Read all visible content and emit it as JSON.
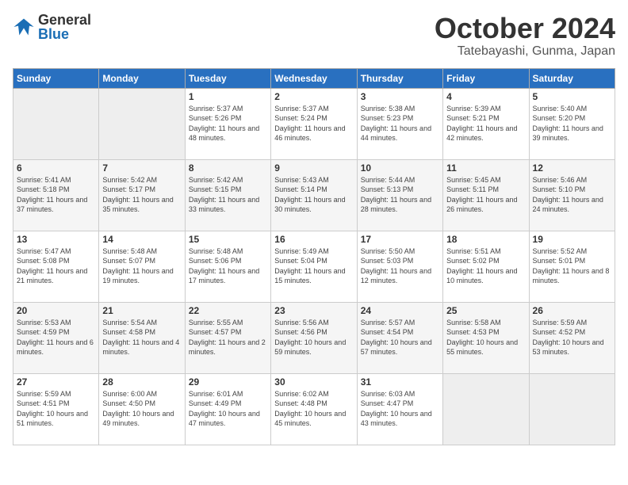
{
  "logo": {
    "general": "General",
    "blue": "Blue"
  },
  "title": "October 2024",
  "location": "Tatebayashi, Gunma, Japan",
  "headers": [
    "Sunday",
    "Monday",
    "Tuesday",
    "Wednesday",
    "Thursday",
    "Friday",
    "Saturday"
  ],
  "weeks": [
    [
      {
        "day": "",
        "info": ""
      },
      {
        "day": "",
        "info": ""
      },
      {
        "day": "1",
        "info": "Sunrise: 5:37 AM\nSunset: 5:26 PM\nDaylight: 11 hours and 48 minutes."
      },
      {
        "day": "2",
        "info": "Sunrise: 5:37 AM\nSunset: 5:24 PM\nDaylight: 11 hours and 46 minutes."
      },
      {
        "day": "3",
        "info": "Sunrise: 5:38 AM\nSunset: 5:23 PM\nDaylight: 11 hours and 44 minutes."
      },
      {
        "day": "4",
        "info": "Sunrise: 5:39 AM\nSunset: 5:21 PM\nDaylight: 11 hours and 42 minutes."
      },
      {
        "day": "5",
        "info": "Sunrise: 5:40 AM\nSunset: 5:20 PM\nDaylight: 11 hours and 39 minutes."
      }
    ],
    [
      {
        "day": "6",
        "info": "Sunrise: 5:41 AM\nSunset: 5:18 PM\nDaylight: 11 hours and 37 minutes."
      },
      {
        "day": "7",
        "info": "Sunrise: 5:42 AM\nSunset: 5:17 PM\nDaylight: 11 hours and 35 minutes."
      },
      {
        "day": "8",
        "info": "Sunrise: 5:42 AM\nSunset: 5:15 PM\nDaylight: 11 hours and 33 minutes."
      },
      {
        "day": "9",
        "info": "Sunrise: 5:43 AM\nSunset: 5:14 PM\nDaylight: 11 hours and 30 minutes."
      },
      {
        "day": "10",
        "info": "Sunrise: 5:44 AM\nSunset: 5:13 PM\nDaylight: 11 hours and 28 minutes."
      },
      {
        "day": "11",
        "info": "Sunrise: 5:45 AM\nSunset: 5:11 PM\nDaylight: 11 hours and 26 minutes."
      },
      {
        "day": "12",
        "info": "Sunrise: 5:46 AM\nSunset: 5:10 PM\nDaylight: 11 hours and 24 minutes."
      }
    ],
    [
      {
        "day": "13",
        "info": "Sunrise: 5:47 AM\nSunset: 5:08 PM\nDaylight: 11 hours and 21 minutes."
      },
      {
        "day": "14",
        "info": "Sunrise: 5:48 AM\nSunset: 5:07 PM\nDaylight: 11 hours and 19 minutes."
      },
      {
        "day": "15",
        "info": "Sunrise: 5:48 AM\nSunset: 5:06 PM\nDaylight: 11 hours and 17 minutes."
      },
      {
        "day": "16",
        "info": "Sunrise: 5:49 AM\nSunset: 5:04 PM\nDaylight: 11 hours and 15 minutes."
      },
      {
        "day": "17",
        "info": "Sunrise: 5:50 AM\nSunset: 5:03 PM\nDaylight: 11 hours and 12 minutes."
      },
      {
        "day": "18",
        "info": "Sunrise: 5:51 AM\nSunset: 5:02 PM\nDaylight: 11 hours and 10 minutes."
      },
      {
        "day": "19",
        "info": "Sunrise: 5:52 AM\nSunset: 5:01 PM\nDaylight: 11 hours and 8 minutes."
      }
    ],
    [
      {
        "day": "20",
        "info": "Sunrise: 5:53 AM\nSunset: 4:59 PM\nDaylight: 11 hours and 6 minutes."
      },
      {
        "day": "21",
        "info": "Sunrise: 5:54 AM\nSunset: 4:58 PM\nDaylight: 11 hours and 4 minutes."
      },
      {
        "day": "22",
        "info": "Sunrise: 5:55 AM\nSunset: 4:57 PM\nDaylight: 11 hours and 2 minutes."
      },
      {
        "day": "23",
        "info": "Sunrise: 5:56 AM\nSunset: 4:56 PM\nDaylight: 10 hours and 59 minutes."
      },
      {
        "day": "24",
        "info": "Sunrise: 5:57 AM\nSunset: 4:54 PM\nDaylight: 10 hours and 57 minutes."
      },
      {
        "day": "25",
        "info": "Sunrise: 5:58 AM\nSunset: 4:53 PM\nDaylight: 10 hours and 55 minutes."
      },
      {
        "day": "26",
        "info": "Sunrise: 5:59 AM\nSunset: 4:52 PM\nDaylight: 10 hours and 53 minutes."
      }
    ],
    [
      {
        "day": "27",
        "info": "Sunrise: 5:59 AM\nSunset: 4:51 PM\nDaylight: 10 hours and 51 minutes."
      },
      {
        "day": "28",
        "info": "Sunrise: 6:00 AM\nSunset: 4:50 PM\nDaylight: 10 hours and 49 minutes."
      },
      {
        "day": "29",
        "info": "Sunrise: 6:01 AM\nSunset: 4:49 PM\nDaylight: 10 hours and 47 minutes."
      },
      {
        "day": "30",
        "info": "Sunrise: 6:02 AM\nSunset: 4:48 PM\nDaylight: 10 hours and 45 minutes."
      },
      {
        "day": "31",
        "info": "Sunrise: 6:03 AM\nSunset: 4:47 PM\nDaylight: 10 hours and 43 minutes."
      },
      {
        "day": "",
        "info": ""
      },
      {
        "day": "",
        "info": ""
      }
    ]
  ]
}
